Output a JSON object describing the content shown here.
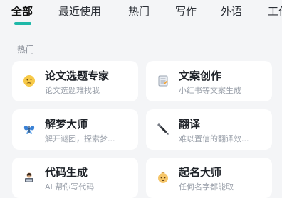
{
  "tabs": [
    {
      "label": "全部",
      "active": true
    },
    {
      "label": "最近使用",
      "active": false
    },
    {
      "label": "热门",
      "active": false
    },
    {
      "label": "写作",
      "active": false
    },
    {
      "label": "外语",
      "active": false
    },
    {
      "label": "工作",
      "active": false
    }
  ],
  "section": {
    "title": "热门"
  },
  "cards": [
    {
      "title": "论文选题专家",
      "desc": "论文选题难找我",
      "icon": "thinking-face-icon"
    },
    {
      "title": "文案创作",
      "desc": "小红书等文案生成",
      "icon": "document-icon"
    },
    {
      "title": "解梦大师",
      "desc": "解开谜团，探索梦...",
      "icon": "butterfly-icon"
    },
    {
      "title": "翻译",
      "desc": "难以置信的翻译效...",
      "icon": "pen-icon"
    },
    {
      "title": "代码生成",
      "desc": "AI 帮你写代码",
      "icon": "programmer-icon"
    },
    {
      "title": "起名大师",
      "desc": "任何名字都能取",
      "icon": "baby-icon"
    }
  ],
  "colors": {
    "accent": "#1eb8a8",
    "background": "#f4f5f7",
    "card": "#ffffff"
  }
}
